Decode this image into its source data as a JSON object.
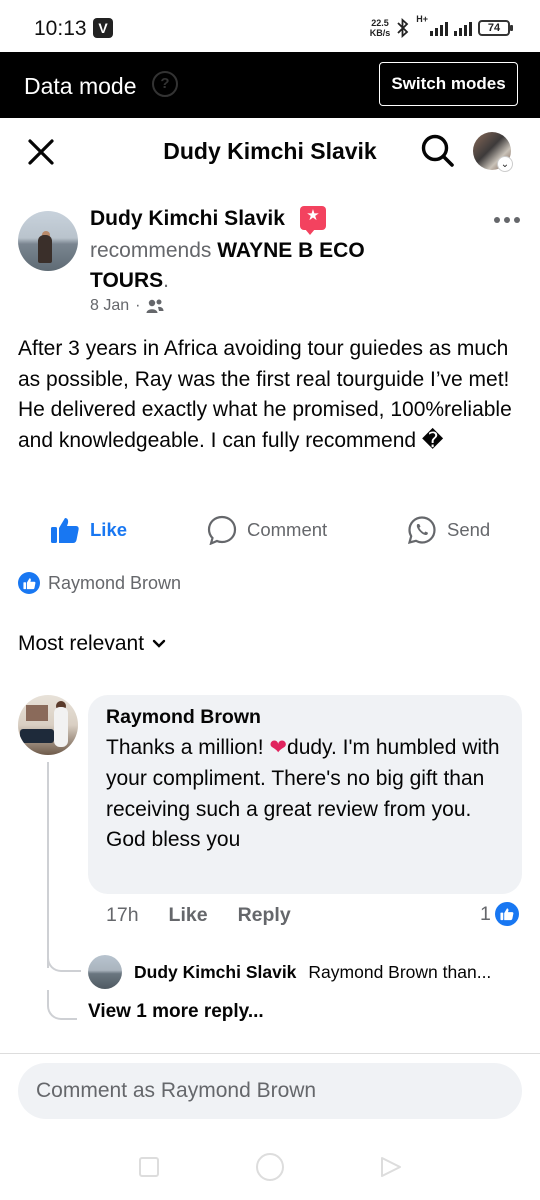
{
  "status_bar": {
    "time": "10:13",
    "app_badge": "V",
    "speed_value": "22.5",
    "speed_unit": "KB/s",
    "network": "H+",
    "battery": "74"
  },
  "data_mode": {
    "title": "Data mode",
    "help_glyph": "?",
    "switch_label": "Switch modes"
  },
  "header": {
    "title": "Dudy Kimchi Slavik"
  },
  "post": {
    "author": "Dudy Kimchi Slavik",
    "recommends_word": "recommends",
    "business": "WAYNE B ECO",
    "business_line2": "TOURS",
    "period": ".",
    "date": "8 Jan",
    "date_separator": "·",
    "audience_icon": "friends-icon",
    "text": "After 3 years in Africa avoiding tour guiedes as much as possible, Ray was the first real tourguide I’ve met! He delivered exactly what he promised, 100%reliable and knowledgeable. I can fully recommend �"
  },
  "actions": {
    "like": "Like",
    "comment": "Comment",
    "send": "Send"
  },
  "reactions": {
    "names": "Raymond Brown"
  },
  "sort": {
    "label": "Most relevant"
  },
  "comment": {
    "author": "Raymond Brown",
    "text_before_heart": "Thanks a million! ",
    "heart": "❤",
    "text_after_heart": "dudy. I'm humbled with your compliment. There's no big gift than receiving such a great review from you. God bless you",
    "time": "17h",
    "like_label": "Like",
    "reply_label": "Reply",
    "like_count": "1"
  },
  "reply": {
    "author": "Dudy Kimchi Slavik",
    "preview": "Raymond Brown than..."
  },
  "view_more": "View 1 more reply...",
  "comment_input": {
    "placeholder": "Comment as Raymond Brown"
  },
  "colors": {
    "facebook_blue": "#1877f2",
    "recommend_pink": "#f3425f",
    "secondary_text": "#65676b",
    "bubble_bg": "#f0f2f5"
  }
}
